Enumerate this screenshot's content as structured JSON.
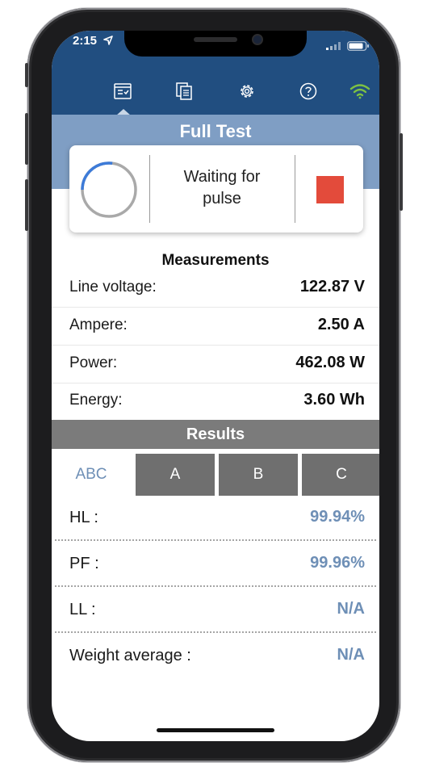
{
  "status_bar": {
    "time": "2:15"
  },
  "nav": {
    "tabs": [
      {
        "icon": "checklist-icon",
        "selected": true
      },
      {
        "icon": "copy-docs-icon",
        "selected": false
      },
      {
        "icon": "gear-icon",
        "selected": false
      },
      {
        "icon": "help-icon",
        "selected": false
      },
      {
        "icon": "wifi-icon",
        "selected": false
      }
    ]
  },
  "page": {
    "title": "Full Test"
  },
  "status_card": {
    "message_line1": "Waiting for",
    "message_line2": "pulse",
    "progress_fraction": 0.27,
    "stop_color": "#e34b3b"
  },
  "measurements": {
    "title": "Measurements",
    "rows": [
      {
        "label": "Line voltage:",
        "value": "122.87 V"
      },
      {
        "label": "Ampere:",
        "value": "2.50 A"
      },
      {
        "label": "Power:",
        "value": "462.08 W"
      },
      {
        "label": "Energy:",
        "value": "3.60 Wh"
      }
    ]
  },
  "results": {
    "title": "Results",
    "phase_tabs": [
      "ABC",
      "A",
      "B",
      "C"
    ],
    "selected_phase": "ABC",
    "rows": [
      {
        "label": "HL :",
        "value": "99.94%"
      },
      {
        "label": "PF :",
        "value": "99.96%"
      },
      {
        "label": "LL :",
        "value": "N/A"
      },
      {
        "label": "Weight average :",
        "value": "N/A"
      }
    ]
  },
  "colors": {
    "header": "#214e80",
    "title_band": "#7f9ec4",
    "accent_value": "#6e8fb6",
    "results_bar": "#7b7b7b",
    "wifi": "#7ec242"
  }
}
